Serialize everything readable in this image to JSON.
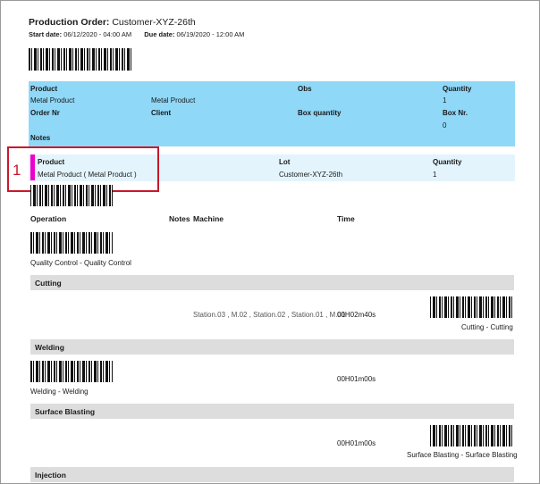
{
  "order": {
    "title_label": "Production Order:",
    "title_value": "Customer-XYZ-26th",
    "start_label": "Start date:",
    "start_value": "06/12/2020 - 04:00 AM",
    "due_label": "Due date:",
    "due_value": "06/19/2020 - 12:00 AM"
  },
  "summary": {
    "product_label": "Product",
    "product_value1": "Metal Product",
    "product_value2": "Metal Product",
    "obs_label": "Obs",
    "quantity_label": "Quantity",
    "quantity_value": "1",
    "order_nr_label": "Order Nr",
    "client_label": "Client",
    "box_quantity_label": "Box quantity",
    "box_nr_label": "Box Nr.",
    "box_nr_value": "0",
    "notes_label": "Notes"
  },
  "lot_row": {
    "marker": "1",
    "product_label": "Product",
    "product_value": "Metal Product ( Metal Product )",
    "lot_label": "Lot",
    "lot_value": "Customer-XYZ-26th",
    "quantity_label": "Quantity",
    "quantity_value": "1"
  },
  "operations_header": {
    "operation": "Operation",
    "notes": "Notes",
    "machine": "Machine",
    "time": "Time"
  },
  "quality_control": "Quality Control - Quality Control",
  "sections": {
    "cutting": {
      "title": "Cutting",
      "machines": "Station.03 , M.02 , Station.02 , Station.01 , M.01",
      "time": "00H02m40s",
      "barcode_label": "Cutting - Cutting"
    },
    "welding": {
      "title": "Welding",
      "time": "00H01m00s",
      "barcode_label": "Welding - Welding"
    },
    "surface_blasting": {
      "title": "Surface Blasting",
      "time": "00H01m00s",
      "barcode_label": "Surface Blasting - Surface Blasting"
    },
    "injection": {
      "title": "Injection"
    }
  }
}
